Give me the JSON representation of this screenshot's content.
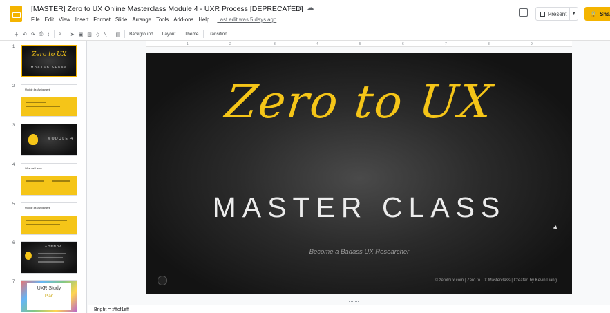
{
  "header": {
    "title": "[MASTER] Zero to UX Online Masterclass Module 4 - UXR Process [DEPRECATED]",
    "menu": [
      "File",
      "Edit",
      "View",
      "Insert",
      "Format",
      "Slide",
      "Arrange",
      "Tools",
      "Add-ons",
      "Help"
    ],
    "last_edit": "Last edit was 5 days ago",
    "present_label": "Present",
    "share_label": "Share"
  },
  "toolbar": {
    "background_label": "Background",
    "layout_label": "Layout",
    "theme_label": "Theme",
    "transition_label": "Transition"
  },
  "ruler": [
    "1",
    "2",
    "3",
    "4",
    "5",
    "6",
    "7",
    "8",
    "9"
  ],
  "filmstrip": {
    "slides": [
      {
        "number": "1",
        "title": "Zero to UX",
        "subtitle": "MASTER CLASS"
      },
      {
        "number": "2",
        "title": "Module 4a: Assignment"
      },
      {
        "number": "3",
        "title": "MODULE 4"
      },
      {
        "number": "4",
        "title": "What we'll learn"
      },
      {
        "number": "5",
        "title": "Module 4a: Assignment"
      },
      {
        "number": "6",
        "title": "AGENDA"
      },
      {
        "number": "7",
        "title": "UXR Study",
        "subtitle": "Plan"
      }
    ]
  },
  "slide": {
    "title": "Zero to UX",
    "subtitle": "MASTER CLASS",
    "tagline": "Become a Badass UX Researcher",
    "footer": "© zeroloux.com | Zero to UX Masterclass | Created by Kevin Liang"
  },
  "notes": {
    "text": "Bright = #ffcf1eff"
  },
  "colors": {
    "accent": "#f4b400",
    "slide_title": "#f5c518",
    "slide_bg": "#1a1a1a"
  }
}
